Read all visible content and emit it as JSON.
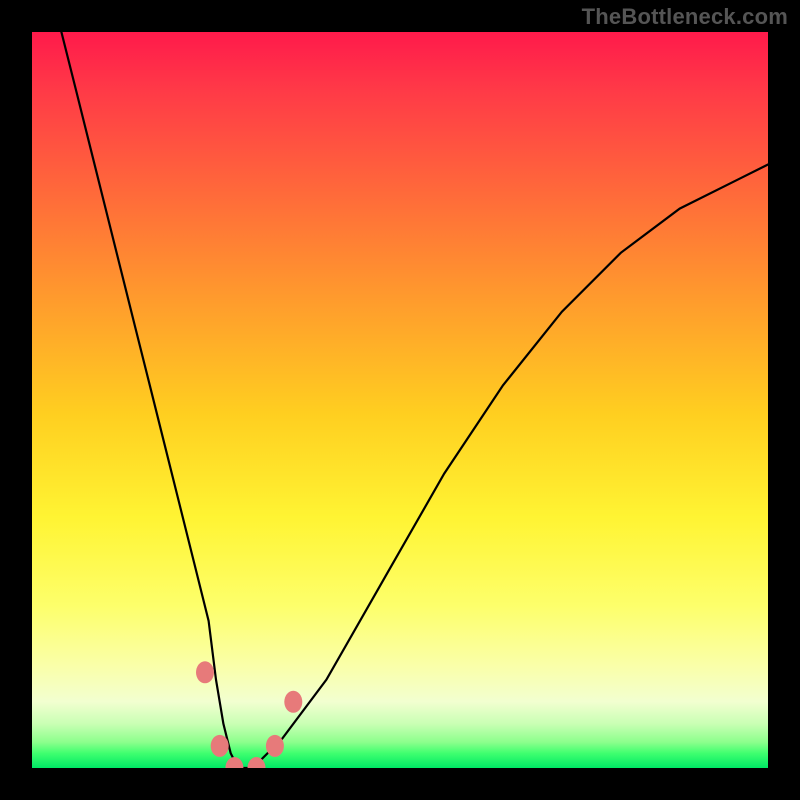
{
  "attribution": "TheBottleneck.com",
  "chart_data": {
    "type": "line",
    "title": "",
    "xlabel": "",
    "ylabel": "",
    "xlim": [
      0,
      100
    ],
    "ylim": [
      0,
      100
    ],
    "grid": false,
    "legend": false,
    "background_gradient": {
      "top_color": "#ff1a4b",
      "mid_color": "#ffff33",
      "bottom_color": "#00e865"
    },
    "series": [
      {
        "name": "bottleneck-curve",
        "color": "#000000",
        "x": [
          4,
          6,
          8,
          10,
          12,
          14,
          16,
          18,
          20,
          22,
          24,
          25,
          26,
          27,
          28,
          30,
          34,
          40,
          48,
          56,
          64,
          72,
          80,
          88,
          96,
          100
        ],
        "y": [
          100,
          92,
          84,
          76,
          68,
          60,
          52,
          44,
          36,
          28,
          20,
          12,
          6,
          2,
          0,
          0,
          4,
          12,
          26,
          40,
          52,
          62,
          70,
          76,
          80,
          82
        ]
      }
    ],
    "markers": [
      {
        "name": "left-upper-dot",
        "x": 23.5,
        "y": 13,
        "color": "#e77a7a"
      },
      {
        "name": "left-lower-dot",
        "x": 25.5,
        "y": 3,
        "color": "#e77a7a"
      },
      {
        "name": "center-dot-1",
        "x": 27.5,
        "y": 0,
        "color": "#e77a7a"
      },
      {
        "name": "center-dot-2",
        "x": 30.5,
        "y": 0,
        "color": "#e77a7a"
      },
      {
        "name": "right-lower-dot",
        "x": 33.0,
        "y": 3,
        "color": "#e77a7a"
      },
      {
        "name": "right-upper-dot",
        "x": 35.5,
        "y": 9,
        "color": "#e77a7a"
      }
    ]
  }
}
